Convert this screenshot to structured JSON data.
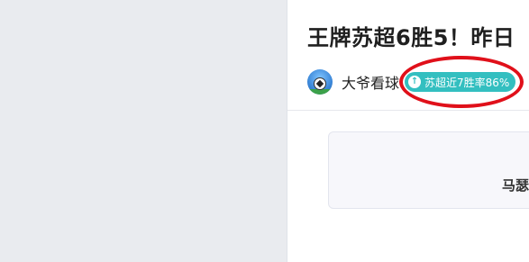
{
  "article": {
    "headline": "王牌苏超6胜5！昨日",
    "author_name": "大爷看球",
    "author_avatar_icon": "soccer-ball-icon",
    "badge_icon": "arrow-up-icon",
    "badge_text": "苏超近7胜率86%"
  },
  "card": {
    "text": "马瑟"
  },
  "colors": {
    "badge": "#33bfc0",
    "highlight": "#e0101a",
    "background": "#e9ebef"
  }
}
